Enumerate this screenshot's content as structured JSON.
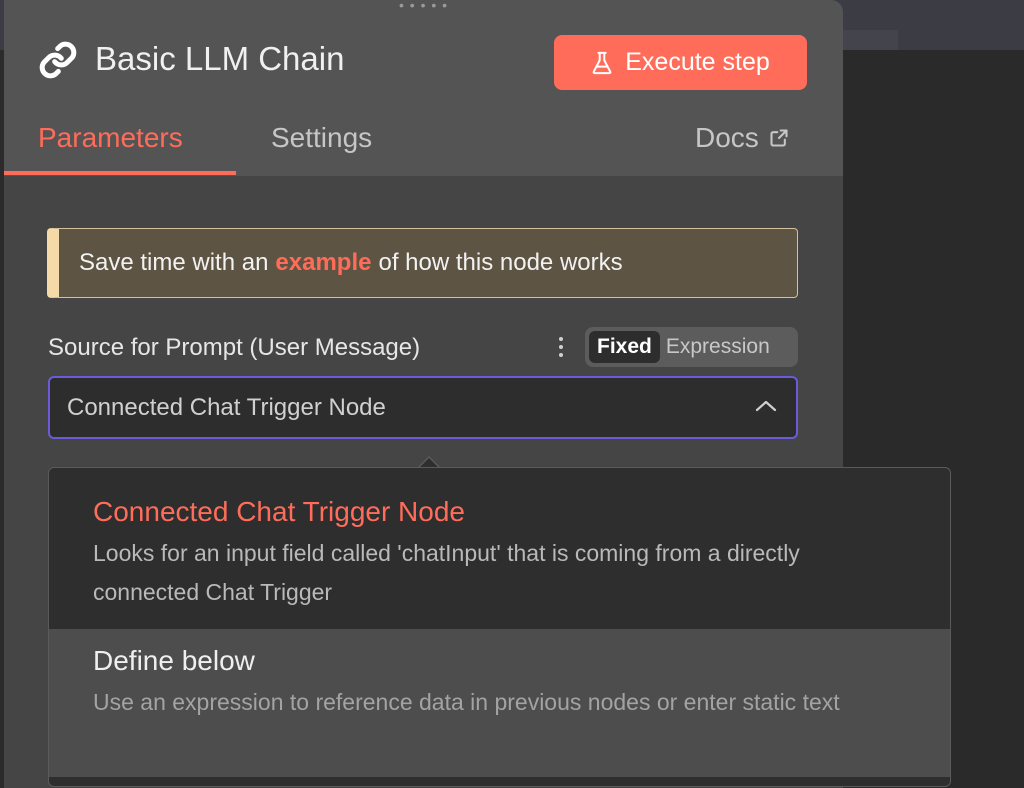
{
  "node": {
    "title": "Basic LLM Chain",
    "execute_label": "Execute step"
  },
  "tabs": {
    "parameters": "Parameters",
    "settings": "Settings",
    "docs": "Docs"
  },
  "callout": {
    "before": "Save time with an",
    "link": "example",
    "after": "of how this node works"
  },
  "field": {
    "label": "Source for Prompt (User Message)",
    "mode_fixed": "Fixed",
    "mode_expression": "Expression",
    "selected": "Connected Chat Trigger Node"
  },
  "dropdown": {
    "options": [
      {
        "title": "Connected Chat Trigger Node",
        "description": "Looks for an input field called 'chatInput' that is coming from a directly connected Chat Trigger"
      },
      {
        "title": "Define below",
        "description": "Use an expression to reference data in previous nodes or enter static text"
      }
    ]
  },
  "colors": {
    "accent": "#ff6d5a",
    "focus_border": "#6b5bd8",
    "callout_bg": "#5e5443"
  },
  "icons": {
    "node": "link-icon",
    "execute": "flask-icon",
    "docs": "external-link-icon",
    "select": "chevron-up-icon"
  }
}
